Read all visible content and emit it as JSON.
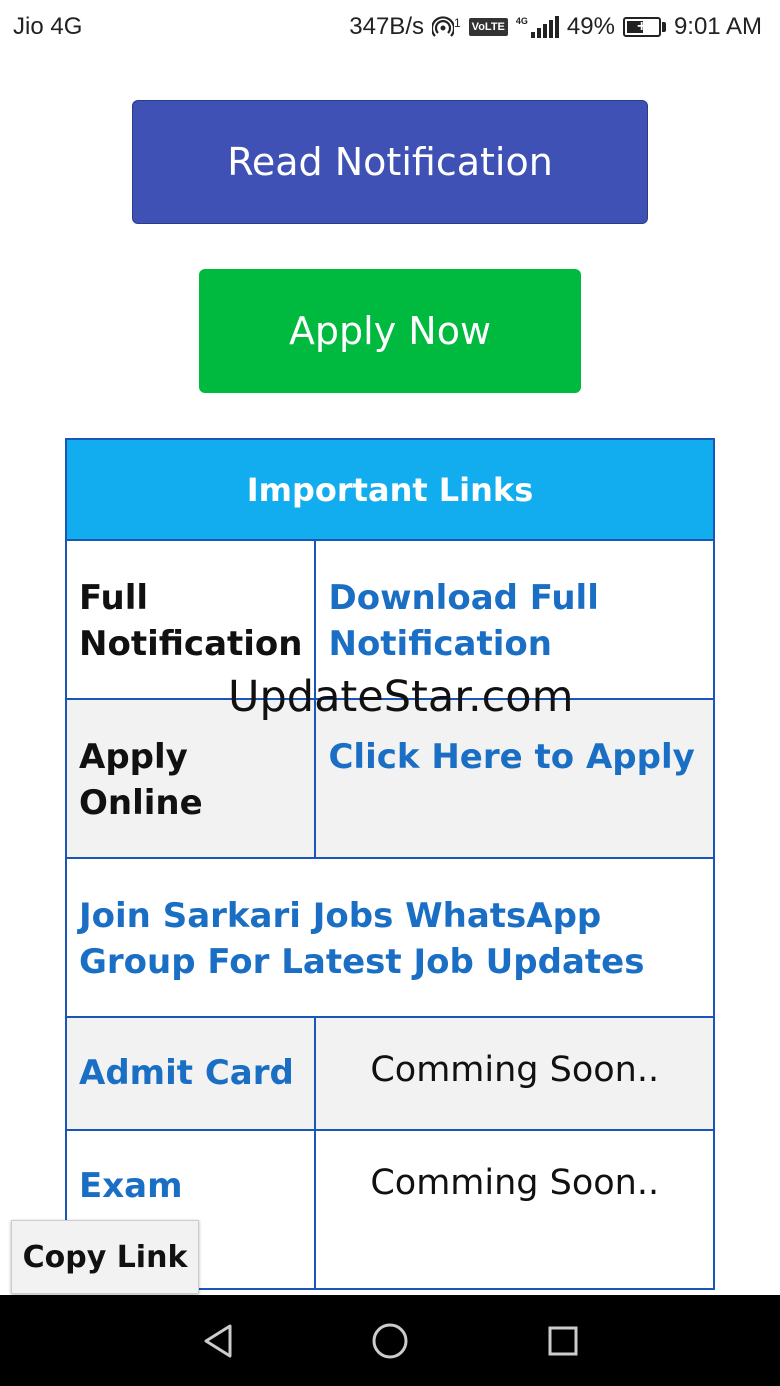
{
  "status_bar": {
    "carrier": "Jio 4G",
    "speed": "347B/s",
    "hotspot_count": "1",
    "volte": "VoLTE",
    "network": "4G",
    "battery": "49%",
    "time": "9:01 AM"
  },
  "buttons": {
    "read_notification": "Read Notification",
    "apply_now": "Apply Now"
  },
  "table": {
    "header": "Important Links",
    "rows": [
      {
        "label": "Full Notification",
        "value": "Download Full Notification"
      },
      {
        "label": "Apply Online",
        "value": "Click Here to Apply"
      },
      {
        "full": "Join Sarkari Jobs WhatsApp Group For Latest Job Updates"
      },
      {
        "label": "Admit Card",
        "value": "Comming Soon.."
      },
      {
        "label": "Exam",
        "value": "Comming Soon.."
      }
    ]
  },
  "watermark": "UpdateStar.com",
  "copy_link": "Copy Link",
  "nav": {
    "back": "back-icon",
    "home": "home-icon",
    "recent": "recent-apps-icon"
  }
}
